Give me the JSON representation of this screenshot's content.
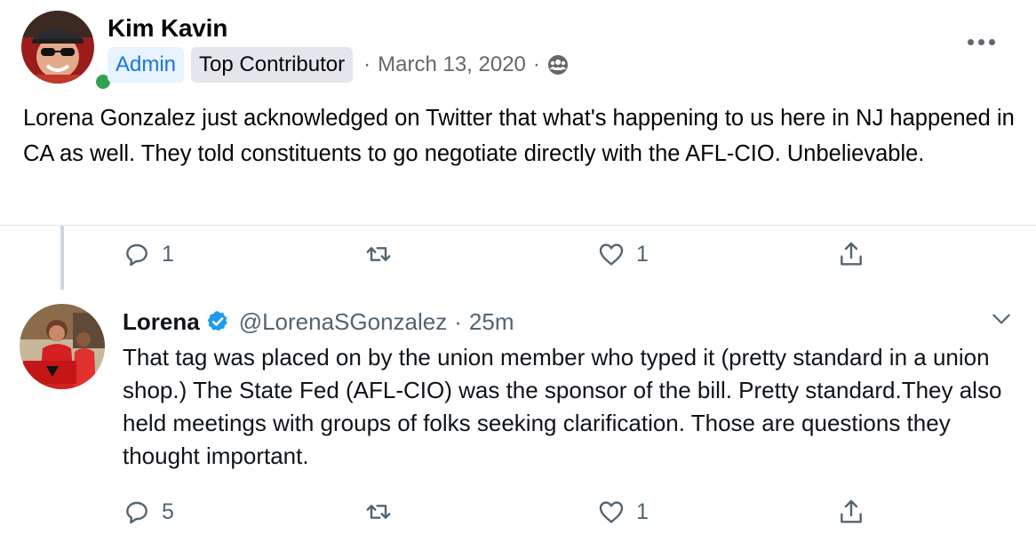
{
  "post": {
    "author": "Kim Kavin",
    "badges": {
      "admin": "Admin",
      "top_contributor": "Top Contributor"
    },
    "separator": "·",
    "date": "March 13, 2020",
    "privacy_icon": "group-audience-icon",
    "text": "Lorena Gonzalez just acknowledged on Twitter that what's happening to us here in NJ happened in CA as well. They told constituents to go negotiate directly with the AFL-CIO. Unbelievable."
  },
  "tweet_above": {
    "actions": {
      "replies": "1",
      "likes": "1"
    }
  },
  "tweet": {
    "name": "Lorena",
    "handle": "@LorenaSGonzalez",
    "separator": "·",
    "time": "25m",
    "text": "That tag was placed on by the union member who typed it (pretty standard in a union shop.) The State Fed (AFL-CIO) was the sponsor of the bill. Pretty standard.They also held meetings with groups of folks seeking clarification. Those are questions they thought important.",
    "actions": {
      "replies": "5",
      "likes": "1"
    }
  },
  "colors": {
    "fb_blue": "#1b74e4",
    "fb_secondary_text": "#65676b",
    "online_green": "#31a24c",
    "twitter_blue": "#1d9bf0",
    "twitter_gray": "#536471",
    "thread_line": "#ccd6dd"
  }
}
